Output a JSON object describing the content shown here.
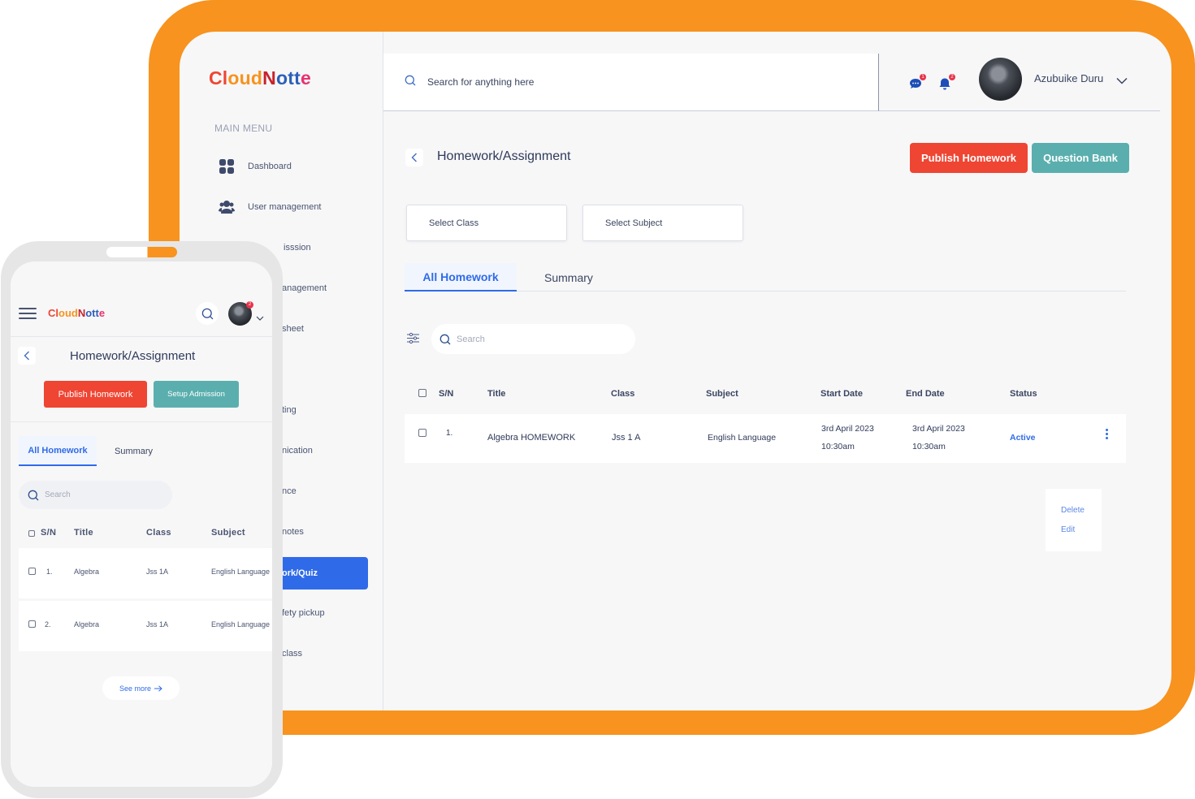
{
  "brand": {
    "logo_parts": [
      "Cl",
      "oud",
      "N",
      "ott",
      "e"
    ],
    "colors": {
      "orange": "#f7931e",
      "red": "#ef4533",
      "teal": "#5aafae",
      "blue": "#2f6be8"
    }
  },
  "sidebar": {
    "section_title": "MAIN MENU",
    "items": [
      {
        "label": "Dashboard",
        "icon": "grid-icon"
      },
      {
        "label": "User management",
        "icon": "users-icon"
      },
      {
        "label": "isssion",
        "icon": "admission-icon"
      },
      {
        "label": "anagement",
        "icon": ""
      },
      {
        "label": "sheet",
        "icon": ""
      },
      {
        "label": "ting",
        "icon": ""
      },
      {
        "label": "nication",
        "icon": ""
      },
      {
        "label": "nce",
        "icon": ""
      },
      {
        "label": "notes",
        "icon": ""
      },
      {
        "label": "ork/Quiz",
        "icon": "",
        "active": true
      },
      {
        "label": "fety pickup",
        "icon": ""
      },
      {
        "label": "class",
        "icon": ""
      }
    ]
  },
  "topbar": {
    "search_placeholder": "Search for anything here",
    "messages_badge": "1",
    "notifications_badge": "2",
    "user_name": "Azubuike Duru"
  },
  "page": {
    "title": "Homework/Assignment",
    "publish_button": "Publish Homework",
    "question_bank_button": "Question Bank",
    "select_class": "Select Class",
    "select_subject": "Select Subject",
    "tabs": [
      {
        "label": "All Homework",
        "active": true
      },
      {
        "label": "Summary",
        "active": false
      }
    ],
    "search_placeholder": "Search",
    "table": {
      "columns": [
        "S/N",
        "Title",
        "Class",
        "Subject",
        "Start Date",
        "End Date",
        "Status"
      ],
      "rows": [
        {
          "sn": "1.",
          "title": "Algebra HOMEWORK",
          "class": "Jss 1 A",
          "subject": "English Language",
          "start_date": "3rd April 2023",
          "start_time": "10:30am",
          "end_date": "3rd April 2023",
          "end_time": "10:30am",
          "status": "Active"
        }
      ]
    },
    "row_menu": [
      "Delete",
      "Edit"
    ]
  },
  "mobile": {
    "logo_parts": [
      "Cl",
      "oud",
      "N",
      "ott",
      "e"
    ],
    "avatar_badge": "2",
    "title": "Homework/Assignment",
    "publish_button": "Publish Homework",
    "setup_button": "Setup Admission",
    "tabs": [
      {
        "label": "All Homework",
        "active": true
      },
      {
        "label": "Summary",
        "active": false
      }
    ],
    "search_placeholder": "Search",
    "table": {
      "columns": [
        "S/N",
        "Title",
        "Class",
        "Subject"
      ],
      "rows": [
        {
          "sn": "1.",
          "title": "Algebra",
          "class": "Jss 1A",
          "subject": "English Language"
        },
        {
          "sn": "2.",
          "title": "Algebra",
          "class": "Jss 1A",
          "subject": "English Language"
        }
      ]
    },
    "see_more": "See more"
  }
}
